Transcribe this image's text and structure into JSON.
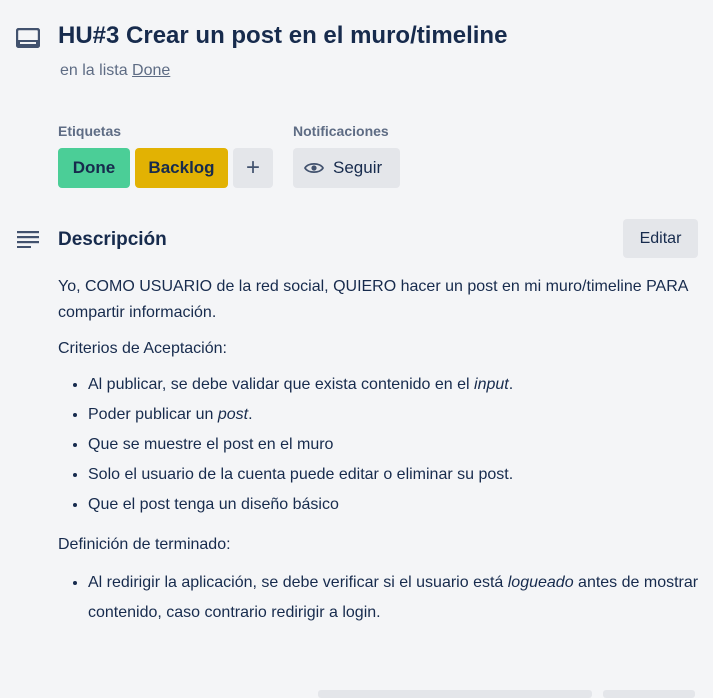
{
  "card": {
    "icon": "card-icon",
    "title": "HU#3 Crear un post en el muro/timeline",
    "list_prefix": "en la lista",
    "list_name": "Done"
  },
  "labels": {
    "heading": "Etiquetas",
    "items": [
      {
        "text": "Done",
        "color": "#4bce97"
      },
      {
        "text": "Backlog",
        "color": "#e2b203"
      }
    ],
    "add_symbol": "+"
  },
  "notifications": {
    "heading": "Notificaciones",
    "follow_label": "Seguir",
    "icon": "eye-icon"
  },
  "description": {
    "icon": "description-lines-icon",
    "title": "Descripción",
    "edit_label": "Editar",
    "intro": "Yo, COMO USUARIO de la red social, QUIERO hacer un post en mi muro/timeline PARA compartir información.",
    "criteria_heading": "Criterios de Aceptación:",
    "criteria": [
      {
        "before": "Al publicar, se debe validar que exista contenido en el ",
        "em": "input",
        "after": "."
      },
      {
        "before": "Poder publicar un ",
        "em": "post",
        "after": "."
      },
      {
        "before": "Que se muestre el post en el muro",
        "em": "",
        "after": ""
      },
      {
        "before": "Solo el usuario de la cuenta puede editar o eliminar su post.",
        "em": "",
        "after": ""
      },
      {
        "before": "Que el post tenga un diseño básico",
        "em": "",
        "after": ""
      }
    ],
    "done_heading": "Definición de terminado:",
    "done_items": [
      {
        "before": "Al redirigir la aplicación, se debe verificar si el usuario está ",
        "em": "logueado",
        "after": " antes de mostrar contenido, caso contrario redirigir a login."
      }
    ]
  }
}
